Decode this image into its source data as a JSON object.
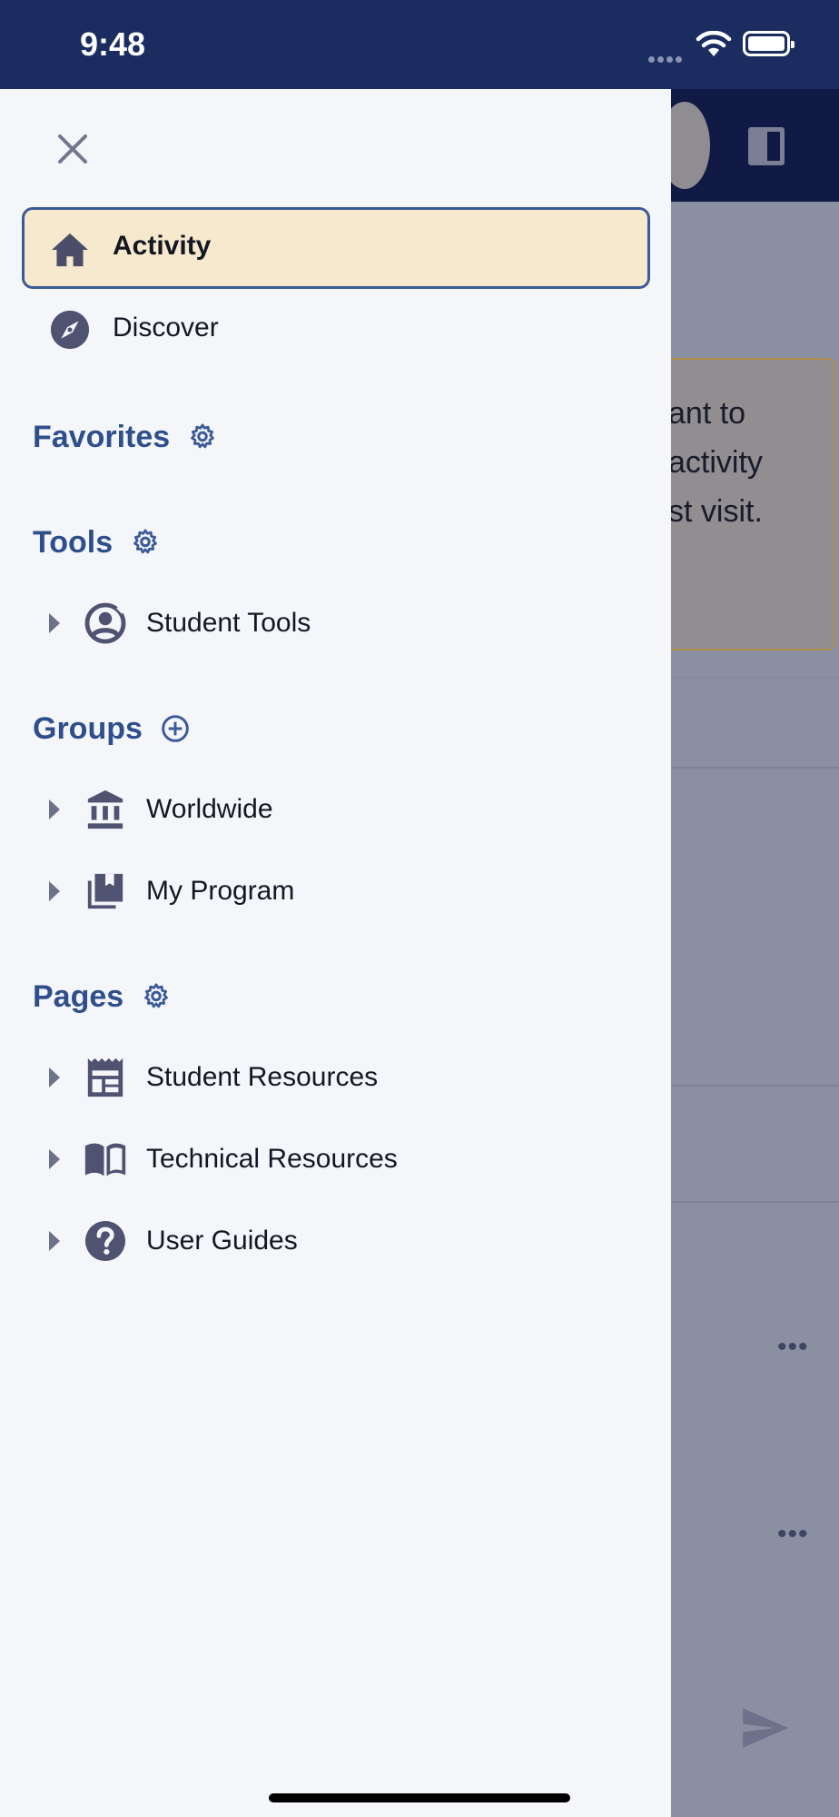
{
  "status_bar": {
    "time": "9:48"
  },
  "background": {
    "notice_lines": [
      "ant to",
      "activity",
      "st visit."
    ]
  },
  "drawer": {
    "nav": [
      {
        "label": "Activity",
        "icon": "home-icon",
        "active": true
      },
      {
        "label": "Discover",
        "icon": "compass-icon",
        "active": false
      }
    ],
    "sections": {
      "favorites": {
        "title": "Favorites",
        "action_icon": "gear-icon"
      },
      "tools": {
        "title": "Tools",
        "action_icon": "gear-icon",
        "items": [
          {
            "label": "Student Tools",
            "icon": "account-circle-icon"
          }
        ]
      },
      "groups": {
        "title": "Groups",
        "action_icon": "add-circle-icon",
        "items": [
          {
            "label": "Worldwide",
            "icon": "bank-icon"
          },
          {
            "label": "My Program",
            "icon": "library-book-icon"
          }
        ]
      },
      "pages": {
        "title": "Pages",
        "action_icon": "gear-icon",
        "items": [
          {
            "label": "Student Resources",
            "icon": "calendar-table-icon"
          },
          {
            "label": "Technical Resources",
            "icon": "book-open-icon"
          },
          {
            "label": "User Guides",
            "icon": "help-circle-icon"
          }
        ]
      }
    }
  },
  "colors": {
    "status_bar": "#1b2c61",
    "section_title": "#2e4f8c",
    "active_bg": "#f7e9ce",
    "active_border": "#3a5a98",
    "icon": "#4f5271",
    "scrim": "#8b8fa2"
  }
}
